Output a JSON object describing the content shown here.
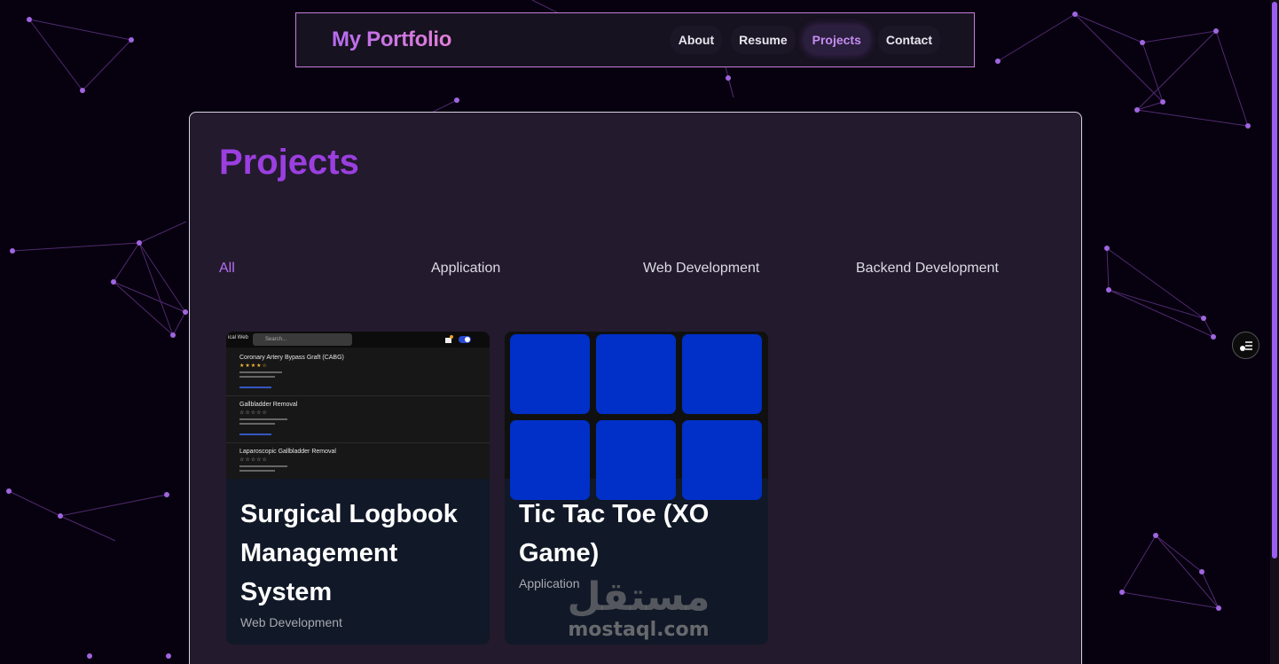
{
  "nav": {
    "brand": "My Portfolio",
    "links": [
      {
        "label": "About",
        "active": false
      },
      {
        "label": "Resume",
        "active": false
      },
      {
        "label": "Projects",
        "active": true
      },
      {
        "label": "Contact",
        "active": false
      }
    ]
  },
  "page": {
    "title": "Projects",
    "filters": [
      "All",
      "Application",
      "Web Development",
      "Backend Development"
    ],
    "active_filter": "All"
  },
  "projects": [
    {
      "title": "Surgical Logbook Management System",
      "category": "Web Development",
      "thumbnail": {
        "brand_fragment": "ical Web",
        "search_placeholder": "Search...",
        "items": [
          {
            "name": "Coronary Artery Bypass Graft (CABG)",
            "stars": "★★★★☆"
          },
          {
            "name": "Gallbladder Removal",
            "stars": "☆☆☆☆☆"
          },
          {
            "name": "Laparoscopic Gallbladder Removal",
            "stars": "☆☆☆☆☆"
          }
        ]
      }
    },
    {
      "title": "Tic Tac Toe (XO Game)",
      "category": "Application",
      "thumbnail": {
        "cell_color": "#0030c8"
      }
    }
  ],
  "watermark": {
    "arabic": "مستقل",
    "latin": "mostaql.com"
  },
  "colors": {
    "accent": "#9b3fe0",
    "brand_gradient_start": "#b66cf0",
    "brand_gradient_end": "#e27fd8",
    "panel": "#231a2e",
    "card": "#111827"
  },
  "icons": {
    "side_button": "filter-list-icon"
  }
}
